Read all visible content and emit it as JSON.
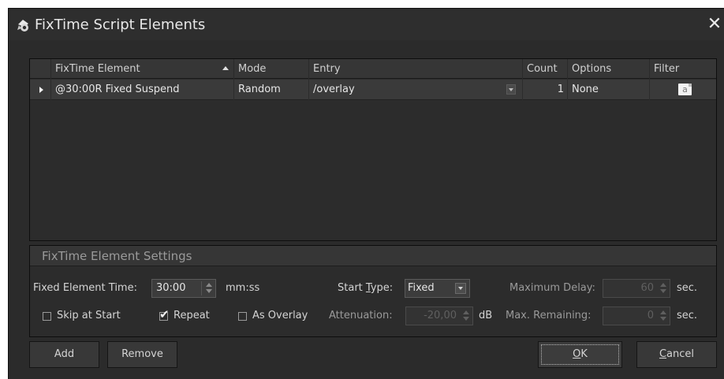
{
  "window": {
    "title": "FixTime Script Elements",
    "close_symbol": "✕"
  },
  "grid": {
    "columns": [
      "FixTime Element",
      "Mode",
      "Entry",
      "Count",
      "Options",
      "Filter"
    ],
    "rows": [
      {
        "element": "@30:00R Fixed Suspend",
        "mode": "Random",
        "entry": "/overlay",
        "count": "1",
        "options": "None",
        "filter_icon": "a"
      }
    ]
  },
  "settings": {
    "title": "FixTime Element Settings",
    "fixed_time_label": "Fixed Element Time:",
    "fixed_time_value": "30:00",
    "fixed_time_unit": "mm:ss",
    "start_type_label_pre": "Start ",
    "start_type_label_u": "T",
    "start_type_label_post": "ype:",
    "start_type_value": "Fixed",
    "max_delay_label": "Maximum Delay:",
    "max_delay_value": "60",
    "max_delay_unit": "sec.",
    "skip_at_start_label": "Skip at Start",
    "skip_at_start_checked": false,
    "repeat_label": "Repeat",
    "repeat_checked": true,
    "as_overlay_label": "As Overlay",
    "as_overlay_checked": false,
    "attenuation_label": "Attenuation:",
    "attenuation_value": "-20,00",
    "attenuation_unit": "dB",
    "max_remaining_label": "Max. Remaining:",
    "max_remaining_value": "0",
    "max_remaining_unit": "sec.",
    "check_mark": "✔"
  },
  "buttons": {
    "add": "Add",
    "remove": "Remove",
    "ok_u": "O",
    "ok_rest": "K",
    "cancel_u": "C",
    "cancel_rest": "ancel"
  },
  "colors": {
    "window_bg": "#2b2b2b",
    "panel_bg": "#2c2c2c",
    "header_bg": "#363636",
    "row_bg": "#3a3a3a",
    "text": "#d8d8d8"
  }
}
